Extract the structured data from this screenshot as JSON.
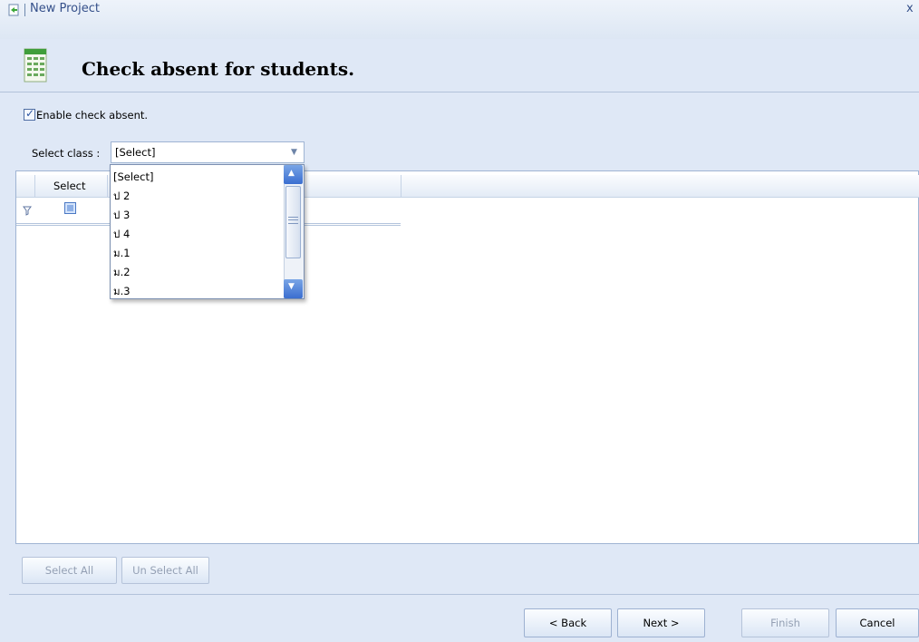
{
  "window": {
    "title": "New Project",
    "close_label": "x"
  },
  "header": {
    "title": "Check absent for students."
  },
  "enable_check": {
    "label": "Enable check absent.",
    "checked": true
  },
  "class_select": {
    "label": "Select class :",
    "value": "[Select]",
    "options": [
      "[Select]",
      "ป 2",
      "ป 3",
      "ป 4",
      "ม.1",
      "ม.2",
      "ม.3"
    ]
  },
  "grid": {
    "columns": [
      "Select",
      ""
    ]
  },
  "buttons": {
    "select_all": "Select All",
    "unselect_all": "Un Select All",
    "back": "< Back",
    "next": "Next >",
    "finish": "Finish",
    "cancel": "Cancel"
  },
  "colors": {
    "accent": "#35508a",
    "background": "#dfe8f6",
    "grid_border": "#9fb4d3"
  }
}
